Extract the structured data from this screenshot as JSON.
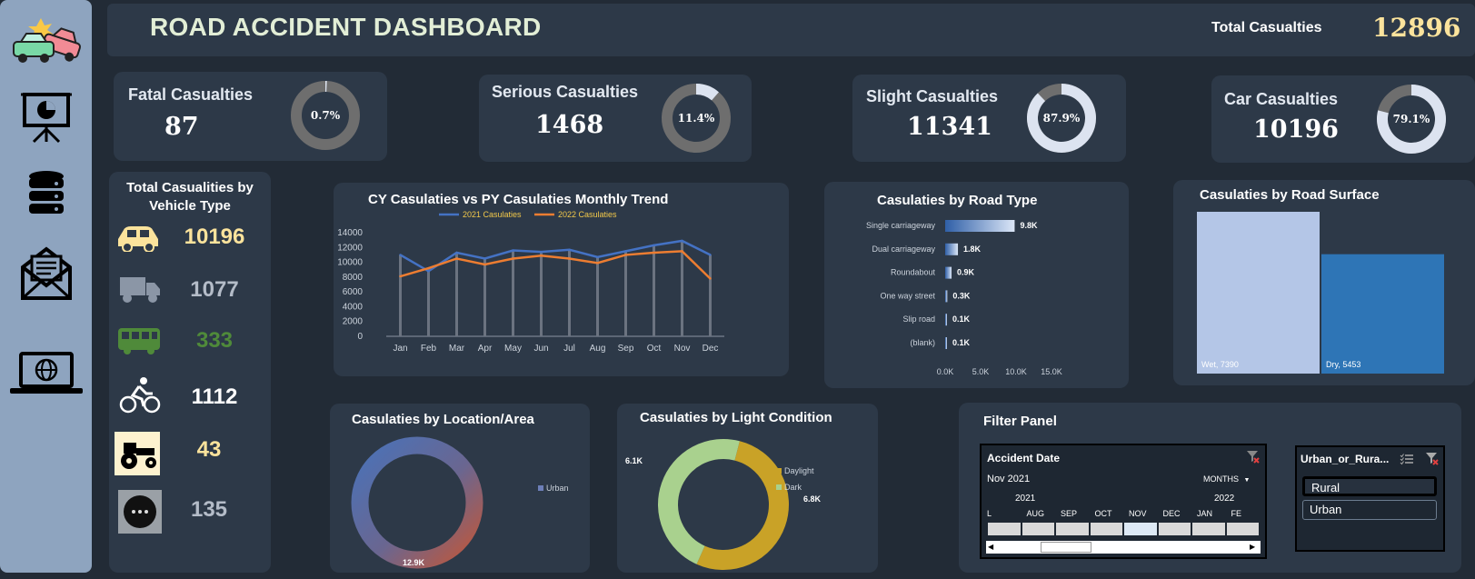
{
  "header": {
    "title": "ROAD ACCIDENT DASHBOARD",
    "total_label": "Total Casualties",
    "total_value": "12896"
  },
  "kpis": [
    {
      "title": "Fatal Casualties",
      "value": "87",
      "pct_label": "0.7%",
      "pct": 0.7
    },
    {
      "title": "Serious Casualties",
      "value": "1468",
      "pct_label": "11.4%",
      "pct": 11.4
    },
    {
      "title": "Slight Casualties",
      "value": "11341",
      "pct_label": "87.9%",
      "pct": 87.9
    },
    {
      "title": "Car Casualties",
      "value": "10196",
      "pct_label": "79.1%",
      "pct": 79.1
    }
  ],
  "vehicle": {
    "title_line1": "Total Casualities by",
    "title_line2": "Vehicle Type",
    "items": [
      {
        "icon": "car-icon",
        "value": "10196",
        "color": "#fbe39c"
      },
      {
        "icon": "truck-icon",
        "value": "1077",
        "color": "#b4bcc8"
      },
      {
        "icon": "bus-icon",
        "value": "333",
        "color": "#4f8a3a"
      },
      {
        "icon": "bicycle-icon",
        "value": "1112",
        "color": "#ffffff"
      },
      {
        "icon": "tractor-icon",
        "value": "43",
        "color": "#fbe39c"
      },
      {
        "icon": "other-vehicle-icon",
        "value": "135",
        "color": "#b4bcc8"
      }
    ]
  },
  "colors": {
    "cy": "#4472c4",
    "py": "#ed7d31",
    "ring_track": "#6e6e6e",
    "ring_fill": "#dce3f0"
  },
  "chart_data": [
    {
      "type": "line",
      "title": "CY Casulaties vs PY Casulaties Monthly Trend",
      "categories": [
        "Jan",
        "Feb",
        "Mar",
        "Apr",
        "May",
        "Jun",
        "Jul",
        "Aug",
        "Sep",
        "Oct",
        "Nov",
        "Dec"
      ],
      "series": [
        {
          "name": "2021 Casulaties",
          "values": [
            11000,
            8800,
            11300,
            10500,
            11600,
            11400,
            11700,
            10700,
            11500,
            12300,
            12900,
            11000
          ]
        },
        {
          "name": "2022 Casulaties",
          "values": [
            8100,
            9200,
            10500,
            9700,
            10500,
            10900,
            10500,
            9900,
            11000,
            11300,
            11500,
            7800
          ]
        }
      ],
      "yticks": [
        "14000",
        "12000",
        "10000",
        "8000",
        "6000",
        "4000",
        "2000",
        "0"
      ],
      "ylim": [
        0,
        14000
      ]
    },
    {
      "type": "bar",
      "title": "Casulaties by Road Type",
      "categories": [
        "Single carriageway",
        "Dual carriageway",
        "Roundabout",
        "One way street",
        "Slip road",
        "(blank)"
      ],
      "values": [
        9.8,
        1.8,
        0.9,
        0.3,
        0.1,
        0.1
      ],
      "labels": [
        "9.8K",
        "1.8K",
        "0.9K",
        "0.3K",
        "0.1K",
        "0.1K"
      ],
      "xticks": [
        "0.0K",
        "5.0K",
        "10.0K",
        "15.0K"
      ],
      "xlim": [
        0,
        15
      ]
    },
    {
      "type": "bar",
      "title": "Casulaties by Road Surface",
      "categories": [
        "Wet",
        "Dry"
      ],
      "values": [
        7390,
        5453
      ],
      "labels": [
        "Wet, 7390",
        "Dry, 5453"
      ]
    },
    {
      "type": "pie",
      "title": "Casulaties by Location/Area",
      "legend": [
        "Urban"
      ],
      "values": [
        12.9
      ],
      "labels": [
        "12.9K"
      ]
    },
    {
      "type": "pie",
      "title": "Casulaties by Light Condition",
      "legend": [
        "Daylight",
        "Dark"
      ],
      "values": [
        6.8,
        6.1
      ],
      "labels": [
        "6.8K",
        "6.1K"
      ]
    }
  ],
  "filter": {
    "title": "Filter Panel",
    "timeline": {
      "header": "Accident Date",
      "selected": "Nov 2021",
      "level": "MONTHS",
      "year1": "2021",
      "year2": "2022",
      "months": [
        "L",
        "AUG",
        "SEP",
        "OCT",
        "NOV",
        "DEC",
        "JAN",
        "FE"
      ]
    },
    "slicer": {
      "header": "Urban_or_Rura...",
      "options": [
        "Rural",
        "Urban"
      ]
    }
  }
}
